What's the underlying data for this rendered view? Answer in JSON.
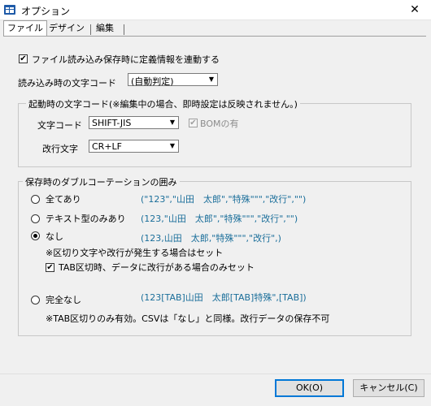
{
  "window": {
    "title": "オプション",
    "close_glyph": "✕"
  },
  "tabs": [
    {
      "label": "ファイル",
      "active": true
    },
    {
      "label": "デザイン",
      "active": false
    },
    {
      "label": "編集",
      "active": false
    }
  ],
  "file_tab": {
    "sync_definition": {
      "label": "ファイル読み込み保存時に定義情報を連動する",
      "checked": true
    },
    "read_encoding": {
      "label": "読み込み時の文字コード",
      "value": "(自動判定)"
    },
    "startup_group": {
      "title": "起動時の文字コード(※編集中の場合、即時設定は反映されません。)",
      "encoding_label": "文字コード",
      "encoding_value": "SHIFT-JIS",
      "bom_label": "BOMの有",
      "bom_checked": true,
      "newline_label": "改行文字",
      "newline_value": "CR+LF"
    },
    "quote_group": {
      "title": "保存時のダブルコーテーションの囲み",
      "options": [
        {
          "label": "全てあり",
          "example": "(\"123\",\"山田　太郎\",\"特殊\"\"\",\"改行\",\"\")",
          "selected": false
        },
        {
          "label": "テキスト型のみあり",
          "example": "(123,\"山田　太郎\",\"特殊\"\"\",\"改行\",\"\")",
          "selected": false
        },
        {
          "label": "なし",
          "example": "(123,山田　太郎,\"特殊\"\"\",\"改行\",)",
          "selected": true
        },
        {
          "label": "完全なし",
          "example": "(123[TAB]山田　太郎[TAB]特殊\",[TAB])",
          "selected": false
        }
      ],
      "none_note": "※区切り文字や改行が発生する場合はセット",
      "tab_option": {
        "label": "TAB区切時、データに改行がある場合のみセット",
        "checked": true
      },
      "complete_note": "※TAB区切りのみ有効。CSVは「なし」と同様。改行データの保存不可"
    }
  },
  "buttons": {
    "ok": "OK(O)",
    "cancel": "キャンセル(C)"
  },
  "check_glyph": "✔",
  "combo_arrow_glyph": "▼",
  "accent_color": "#0078d7",
  "example_color": "#1a6e9a"
}
